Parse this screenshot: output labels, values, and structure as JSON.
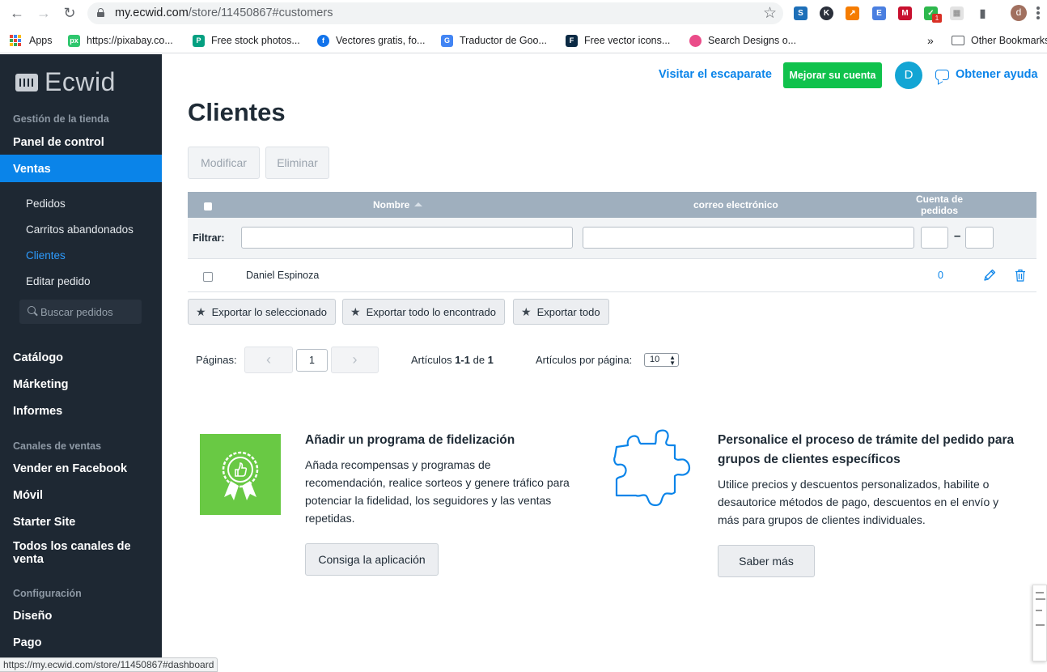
{
  "browser": {
    "url_host": "my.ecwid.com",
    "url_path": "/store/11450867#customers",
    "profile_initial": "d",
    "extension_badge": "1",
    "bookmarks": [
      {
        "label": "Apps",
        "icon": "apps-grid-icon"
      },
      {
        "label": "https://pixabay.co...",
        "icon": "pixabay-icon",
        "color": "#2ec66d"
      },
      {
        "label": "Free stock photos...",
        "icon": "pexels-icon",
        "color": "#05a081"
      },
      {
        "label": "Vectores gratis, fo...",
        "icon": "freepik-icon",
        "color": "#1273eb"
      },
      {
        "label": "Traductor de Goo...",
        "icon": "google-translate-icon",
        "color": "#4285f4"
      },
      {
        "label": "Free vector icons...",
        "icon": "flaticon-icon",
        "color": "#0b2a44"
      },
      {
        "label": "Search Designs o...",
        "icon": "dribbble-icon",
        "color": "#ea4c89"
      }
    ],
    "overflow": "»",
    "other_bookmarks": "Other Bookmarks",
    "status_url": "https://my.ecwid.com/store/11450867#dashboard"
  },
  "sidebar": {
    "logo": "Ecwid",
    "section_store": "Gestión de la tienda",
    "panel": "Panel de control",
    "sales": "Ventas",
    "sales_items": [
      "Pedidos",
      "Carritos abandonados",
      "Clientes",
      "Editar pedido"
    ],
    "search_placeholder": "Buscar pedidos",
    "catalog": "Catálogo",
    "marketing": "Márketing",
    "reports": "Informes",
    "section_channels": "Canales de ventas",
    "facebook": "Vender en Facebook",
    "mobile": "Móvil",
    "starter": "Starter Site",
    "all_channels": "Todos los canales de venta",
    "section_config": "Configuración",
    "design": "Diseño",
    "payment": "Pago"
  },
  "topbar": {
    "storefront": "Visitar el escaparate",
    "upgrade": "Mejorar su cuenta",
    "avatar": "D",
    "help": "Obtener ayuda"
  },
  "page": {
    "title": "Clientes",
    "edit_button": "Modificar",
    "delete_button": "Eliminar"
  },
  "table": {
    "col_name": "Nombre",
    "col_email": "correo electrónico",
    "col_orders": "Cuenta de pedidos",
    "filter_label": "Filtrar:",
    "filter_dash": "–",
    "rows": [
      {
        "name": "Daniel Espinoza",
        "email": "",
        "orders": "0"
      }
    ]
  },
  "export": {
    "selected": "Exportar lo seleccionado",
    "found": "Exportar todo lo encontrado",
    "all": "Exportar todo"
  },
  "pagination": {
    "pages_label": "Páginas:",
    "current_page": "1",
    "articles_prefix": "Artículos ",
    "articles_range": "1-1",
    "articles_of": " de ",
    "articles_total": "1",
    "per_page_label": "Artículos por página:",
    "per_page_value": "10"
  },
  "promos": [
    {
      "title": "Añadir un programa de fidelización",
      "text": "Añada recompensas y programas de recomendación, realice sorteos y genere tráfico para potenciar la fidelidad, los seguidores y las ventas repetidas.",
      "button": "Consiga la aplicación"
    },
    {
      "title": "Personalice el proceso de trámite del pedido para grupos de clientes específicos",
      "text": "Utilice precios y descuentos personalizados, habilite o desautorice métodos de pago, descuentos en el envío y más para grupos de clientes individuales.",
      "button": "Saber más"
    }
  ],
  "colors": {
    "sidebar_bg": "#1e2833",
    "accent_blue": "#0a84e9",
    "upgrade_green": "#10c24c",
    "table_header": "#9fafbe",
    "promo_green": "#69c944"
  }
}
